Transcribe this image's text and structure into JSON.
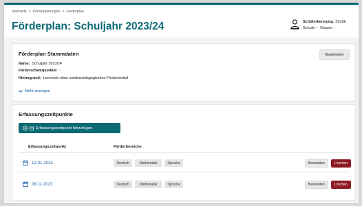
{
  "breadcrumb": [
    "Startseite",
    "Förderplanungen",
    "Förderplan"
  ],
  "breadcrumb_separator": ">",
  "page_title": "Förderplan: Schuljahr 2023/24",
  "user": {
    "icon": "person-icon",
    "id_label": "Schülerkennung:",
    "id_value": "25n0b",
    "school_label": "Schule: -",
    "class_label": "Klasse: -"
  },
  "stammdaten": {
    "title": "Förderplan Stammdaten",
    "edit_label": "Bearbeiten",
    "fields": [
      {
        "label": "Name:",
        "value": "Schuljahr 2023/24"
      },
      {
        "label": "Förderschwerpunkt/e:",
        "value": "-"
      },
      {
        "label": "Hintergrund:",
        "value": "Lernende ohne sonderpädagogischen Förderbedarf"
      }
    ],
    "more_label": "Mehr anzeigen"
  },
  "erfassung": {
    "title": "Erfassungszeitpunkte",
    "add_label": "Erfassungszeitpunkt hinzufügen",
    "columns": [
      "Erfassungszeitpunkt",
      "Förderbereiche"
    ],
    "rows": [
      {
        "date": "12.01.2024",
        "tags": [
          "Deutsch",
          "Mathematik",
          "Sprache"
        ],
        "edit": "Bearbeiten",
        "delete": "Löschen"
      },
      {
        "date": "08.11.2023",
        "tags": [
          "Deutsch",
          "Mathematik",
          "Sprache"
        ],
        "edit": "Bearbeiten",
        "delete": "Löschen"
      }
    ]
  },
  "colors": {
    "accent": "#0c6a74",
    "link": "#1b5fa8",
    "danger": "#8e1a25"
  }
}
